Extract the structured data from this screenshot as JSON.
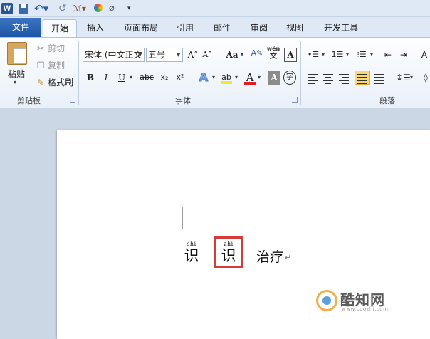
{
  "quick_access": {
    "app_icon": "word-icon",
    "app_letter": "W",
    "undo_glyph": "↶▾",
    "redo_glyph": "↺",
    "format_glyph": "ℳ▾",
    "clear_glyph": "⌀",
    "more_glyph": "▾"
  },
  "tabs": {
    "file": "文件",
    "home": "开始",
    "insert": "插入",
    "layout": "页面布局",
    "references": "引用",
    "mailings": "邮件",
    "review": "审阅",
    "view": "视图",
    "developer": "开发工具"
  },
  "clipboard": {
    "paste": "粘贴",
    "cut": "剪切",
    "copy": "复制",
    "format_painter": "格式刷",
    "group_label": "剪贴板"
  },
  "font": {
    "font_name": "宋体 (中文正文",
    "font_size": "五号",
    "grow": "A˄",
    "shrink": "A˅",
    "change_case": "Aa",
    "clear_format": "A✎",
    "phonetic_top": "wén",
    "phonetic_bottom": "文",
    "char_border": "A",
    "bold": "B",
    "italic": "I",
    "underline": "U",
    "strike": "abc",
    "subscript": "x₂",
    "superscript": "x²",
    "text_effect": "A",
    "highlight": "ab",
    "font_color": "A",
    "char_shading": "A",
    "enclose": "字",
    "group_label": "字体"
  },
  "paragraph": {
    "bullets": "•☰",
    "numbering": "1☰",
    "multilevel": "⁝☰",
    "dec_indent": "⇤",
    "inc_indent": "⇥",
    "sort_partial": "A",
    "line_spacing": "↕☰",
    "shading_partial": "◊",
    "group_label": "段落"
  },
  "document": {
    "ruby_1_pinyin": "shí",
    "ruby_1_char": "识",
    "ruby_2_pinyin": "zhì",
    "ruby_2_char": "识",
    "plain_text": "治疗",
    "para_mark": "↵"
  },
  "watermark": {
    "name": "酷知网",
    "url": "www.coozhi.com"
  },
  "colors": {
    "file_tab": "#1f56a6",
    "highlight_box": "#d43b3b",
    "active_align": "#fbd774"
  }
}
